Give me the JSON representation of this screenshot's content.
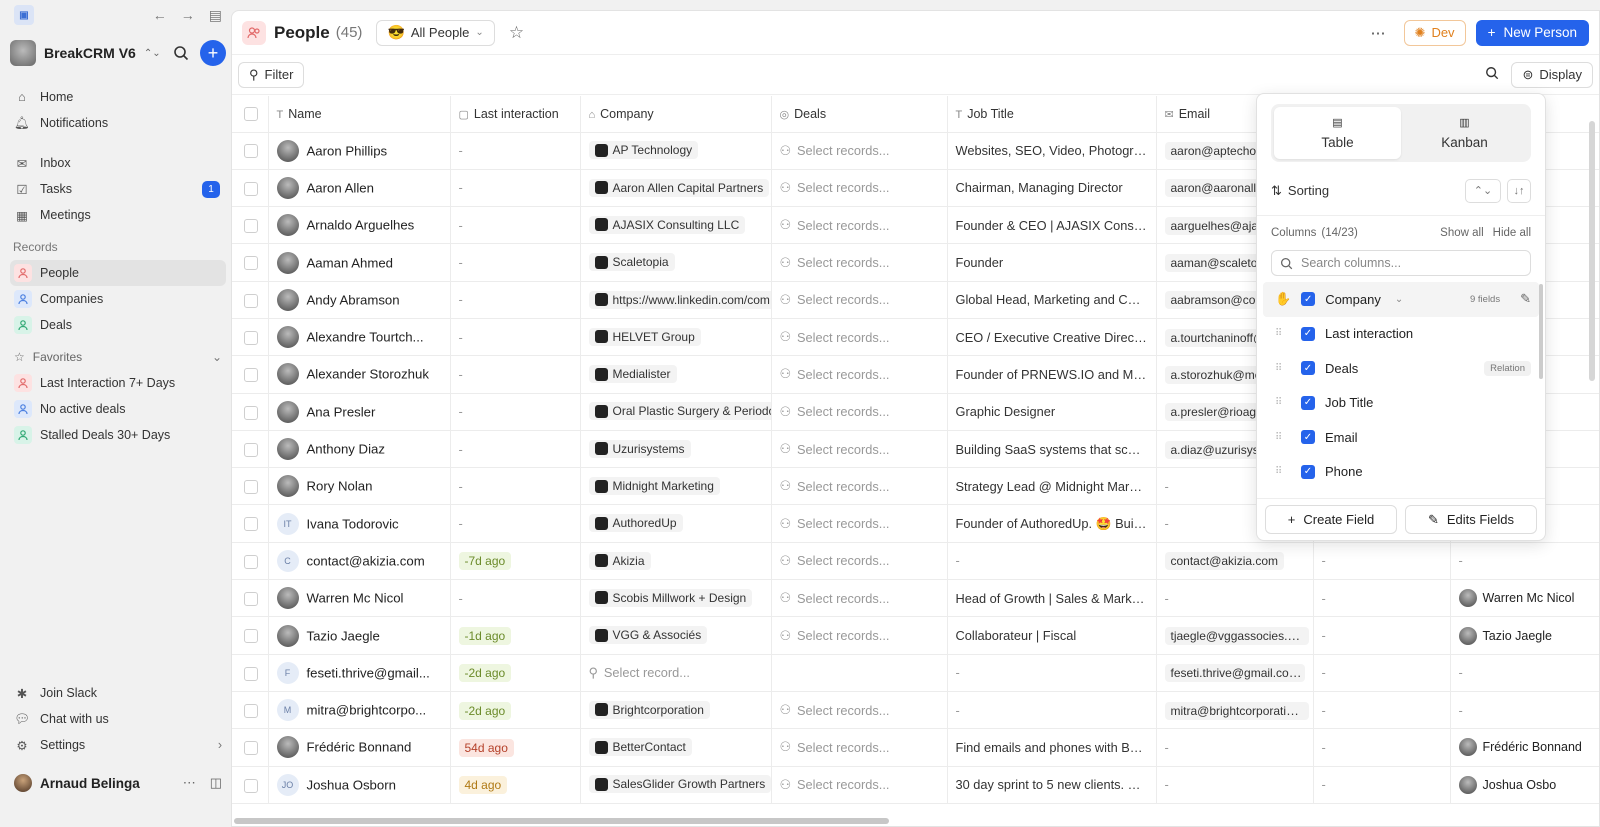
{
  "sidebar": {
    "workspace": "BreakCRM V6",
    "nav": [
      {
        "label": "Home",
        "icon": "home-icon"
      },
      {
        "label": "Notifications",
        "icon": "bell-icon"
      }
    ],
    "nav2": [
      {
        "label": "Inbox",
        "icon": "inbox-icon"
      },
      {
        "label": "Tasks",
        "icon": "tasks-icon",
        "badge": "1"
      },
      {
        "label": "Meetings",
        "icon": "calendar-icon"
      }
    ],
    "records_label": "Records",
    "records": [
      {
        "label": "People",
        "type": "people"
      },
      {
        "label": "Companies",
        "type": "comp"
      },
      {
        "label": "Deals",
        "type": "deal"
      }
    ],
    "favorites_label": "Favorites",
    "favorites": [
      {
        "label": "Last Interaction 7+ Days",
        "type": "people"
      },
      {
        "label": "No active deals",
        "type": "comp"
      },
      {
        "label": "Stalled Deals 30+ Days",
        "type": "deal"
      }
    ],
    "bottom": [
      {
        "label": "Join Slack",
        "icon": "slack-icon"
      },
      {
        "label": "Chat with us",
        "icon": "chat-icon"
      },
      {
        "label": "Settings",
        "icon": "settings-icon"
      }
    ],
    "user": "Arnaud Belinga"
  },
  "header": {
    "title": "People",
    "count": "(45)",
    "view": "All People",
    "view_emoji": "😎",
    "dev_label": "Dev",
    "new_label": "New Person"
  },
  "toolbar": {
    "filter_label": "Filter",
    "display_label": "Display"
  },
  "columns": [
    "Name",
    "Last interaction",
    "Company",
    "Deals",
    "Job Title",
    "Email",
    "",
    ""
  ],
  "rows": [
    {
      "name": "Aaron Phillips",
      "init": "",
      "last": "-",
      "last_tone": "",
      "company": "AP Technology",
      "deal": "Select records...",
      "job": "Websites, SEO, Video, Photograp...",
      "email": "aaron@aptechoke",
      "phone": "",
      "owner": "",
      "owner_name": ""
    },
    {
      "name": "Aaron Allen",
      "init": "",
      "last": "-",
      "last_tone": "",
      "company": "Aaron Allen Capital Partners",
      "deal": "Select records...",
      "job": "Chairman, Managing Director",
      "email": "aaron@aaronaller",
      "phone": "",
      "owner": "",
      "owner_name": ""
    },
    {
      "name": "Arnaldo Arguelhes",
      "init": "",
      "last": "-",
      "last_tone": "",
      "company": "AJASIX Consulting LLC",
      "deal": "Select records...",
      "job": "Founder & CEO | AJASIX Consulti...",
      "email": "aarguelhes@ajas",
      "phone": "",
      "owner": "",
      "owner_name": ""
    },
    {
      "name": "Aaman Ahmed",
      "init": "",
      "last": "-",
      "last_tone": "",
      "company": "Scaletopia",
      "deal": "Select records...",
      "job": "Founder",
      "email": "aaman@scaletop",
      "phone": "",
      "owner": "",
      "owner_name": ""
    },
    {
      "name": "Andy Abramson",
      "init": "",
      "last": "-",
      "last_tone": "",
      "company": "https://www.linkedin.com/com",
      "deal": "Select records...",
      "job": "Global Head, Marketing and Com...",
      "email": "aabramson@com",
      "phone": "",
      "owner": "",
      "owner_name": ""
    },
    {
      "name": "Alexandre Tourtch...",
      "init": "",
      "last": "-",
      "last_tone": "",
      "company": "HELVET Group",
      "deal": "Select records...",
      "job": "CEO / Executive Creative Director",
      "email": "a.tourtchaninoff@",
      "phone": "",
      "owner": "",
      "owner_name": ""
    },
    {
      "name": "Alexander Storozhuk",
      "init": "",
      "last": "-",
      "last_tone": "",
      "company": "Medialister",
      "deal": "Select records...",
      "job": "Founder of PRNEWS.IO and Medi...",
      "email": "a.storozhuk@me",
      "phone": "",
      "owner": "",
      "owner_name": ""
    },
    {
      "name": "Ana Presler",
      "init": "",
      "last": "-",
      "last_tone": "",
      "company": "Oral Plastic Surgery & Periodo",
      "deal": "Select records...",
      "job": "Graphic Designer",
      "email": "a.presler@rioage",
      "phone": "",
      "owner": "",
      "owner_name": ""
    },
    {
      "name": "Anthony Diaz",
      "init": "",
      "last": "-",
      "last_tone": "",
      "company": "Uzurisystems",
      "deal": "Select records...",
      "job": "Building SaaS systems that scale...",
      "email": "a.diaz@uzurisyste",
      "phone": "",
      "owner": "",
      "owner_name": ""
    },
    {
      "name": "Rory Nolan",
      "init": "",
      "last": "-",
      "last_tone": "",
      "company": "Midnight Marketing",
      "deal": "Select records...",
      "job": "Strategy Lead @ Midnight Market...",
      "email": "-",
      "phone": "",
      "owner": "",
      "owner_name": ""
    },
    {
      "name": "Ivana Todorovic",
      "init": "IT",
      "last": "-",
      "last_tone": "",
      "company": "AuthoredUp",
      "deal": "Select records...",
      "job": "Founder of AuthoredUp. 🤩 Built ...",
      "email": "-",
      "phone": "",
      "owner": "",
      "owner_name": ""
    },
    {
      "name": "contact@akizia.com",
      "init": "C",
      "last": "-7d ago",
      "last_tone": "g",
      "company": "Akizia",
      "deal": "Select records...",
      "job": "-",
      "email": "contact@akizia.com",
      "phone": "-",
      "owner": "-",
      "owner_name": ""
    },
    {
      "name": "Warren Mc Nicol",
      "init": "",
      "last": "-",
      "last_tone": "",
      "company": "Scobis Millwork + Design",
      "deal": "Select records...",
      "job": "Head of Growth | Sales & Marketi...",
      "email": "-",
      "phone": "-",
      "owner": "",
      "owner_name": "Warren Mc Nicol"
    },
    {
      "name": "Tazio Jaegle",
      "init": "",
      "last": "-1d ago",
      "last_tone": "g",
      "company": "VGG & Associés",
      "deal": "Select records...",
      "job": "Collaborateur | Fiscal",
      "email": "tjaegle@vggassocies.c...",
      "phone": "-",
      "owner": "",
      "owner_name": "Tazio Jaegle"
    },
    {
      "name": "feseti.thrive@gmail...",
      "init": "F",
      "last": "-2d ago",
      "last_tone": "g",
      "company": "",
      "deal": "Select record...",
      "job": "-",
      "email": "feseti.thrive@gmail.com",
      "phone": "-",
      "owner": "-",
      "owner_name": ""
    },
    {
      "name": "mitra@brightcorpo...",
      "init": "M",
      "last": "-2d ago",
      "last_tone": "g",
      "company": "Brightcorporation",
      "deal": "Select records...",
      "job": "-",
      "email": "mitra@brightcorporatio...",
      "phone": "-",
      "owner": "-",
      "owner_name": ""
    },
    {
      "name": "Frédéric Bonnand",
      "init": "",
      "last": "54d ago",
      "last_tone": "r",
      "company": "BetterContact",
      "deal": "Select records...",
      "job": "Find emails and phones with Bett...",
      "email": "-",
      "phone": "-",
      "owner": "",
      "owner_name": "Frédéric Bonnand"
    },
    {
      "name": "Joshua Osborn",
      "init": "JO",
      "last": "4d ago",
      "last_tone": "o",
      "company": "SalesGlider Growth Partners",
      "deal": "Select records...",
      "job": "30 day sprint to 5 new clients. G...",
      "email": "-",
      "phone": "-",
      "owner": "",
      "owner_name": "Joshua Osbo"
    }
  ],
  "panel": {
    "table_label": "Table",
    "kanban_label": "Kanban",
    "sorting_label": "Sorting",
    "columns_label": "Columns",
    "columns_count": "(14/23)",
    "show_all": "Show all",
    "hide_all": "Hide all",
    "search_placeholder": "Search columns...",
    "items": [
      {
        "label": "Company",
        "tag": "9 fields"
      },
      {
        "label": "Last interaction",
        "tag": ""
      },
      {
        "label": "Deals",
        "tag": "Relation"
      },
      {
        "label": "Job Title",
        "tag": ""
      },
      {
        "label": "Email",
        "tag": ""
      },
      {
        "label": "Phone",
        "tag": ""
      }
    ],
    "create_label": "Create Field",
    "edit_label": "Edits Fields"
  }
}
